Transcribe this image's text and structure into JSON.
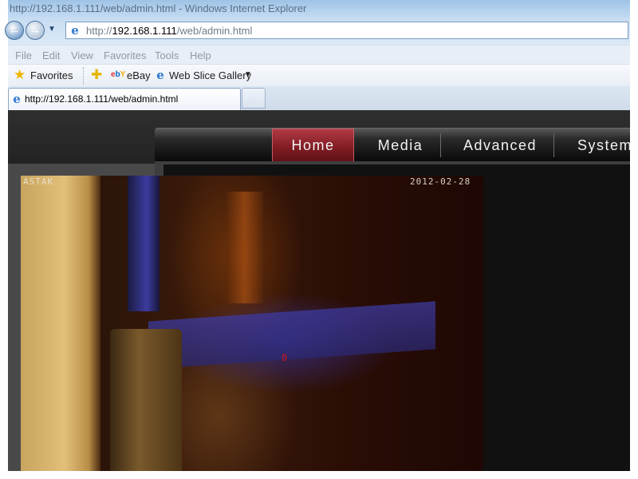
{
  "window": {
    "title": "http://192.168.1.111/web/admin.html - Windows Internet Explorer"
  },
  "toolbar": {
    "back_label": "←",
    "forward_label": "→",
    "address_prefix": "http://",
    "address_host": "192.168.1.111",
    "address_path": "/web/admin.html"
  },
  "menu": {
    "items": [
      "File",
      "Edit",
      "View",
      "Favorites",
      "Tools",
      "Help"
    ]
  },
  "favorites_bar": {
    "favorites_label": "Favorites",
    "ebay_label": "eBay",
    "webslice_label": "Web Slice Gallery"
  },
  "tabs": {
    "active_label": "http://192.168.1.111/web/admin.html"
  },
  "nav": {
    "items": [
      "Home",
      "Media",
      "Advanced",
      "System"
    ],
    "active": "Home"
  },
  "camera": {
    "osd_name": "ASTAK",
    "osd_date": "2012-02-28",
    "marker": "0"
  },
  "page": {
    "left_marker": "0"
  },
  "colors": {
    "nav_active": "#8e2530",
    "marker_red": "#c81818",
    "page_bg": "#4a4a4a"
  }
}
